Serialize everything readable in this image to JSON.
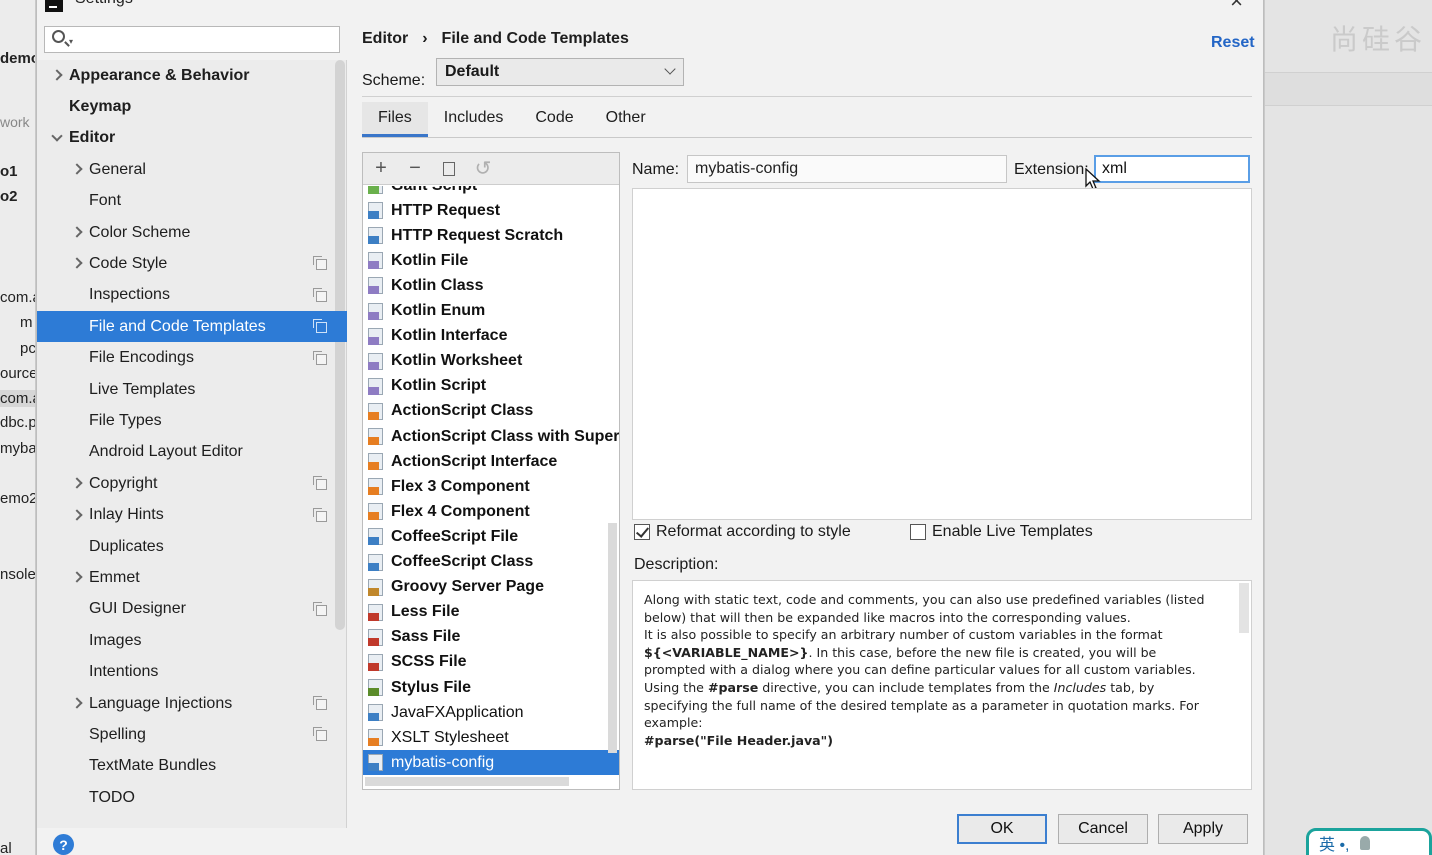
{
  "dialog": {
    "title": "Settings"
  },
  "search": {
    "placeholder": ""
  },
  "tree": [
    {
      "label": "Appearance & Behavior",
      "bold": true,
      "chevron": "right",
      "indent": 0,
      "copy": false
    },
    {
      "label": "Keymap",
      "bold": true,
      "chevron": "",
      "indent": 0,
      "copy": false
    },
    {
      "label": "Editor",
      "bold": true,
      "chevron": "down",
      "indent": 0,
      "copy": false
    },
    {
      "label": "General",
      "bold": false,
      "chevron": "right",
      "indent": 1,
      "copy": false
    },
    {
      "label": "Font",
      "bold": false,
      "chevron": "",
      "indent": 1,
      "copy": false
    },
    {
      "label": "Color Scheme",
      "bold": false,
      "chevron": "right",
      "indent": 1,
      "copy": false
    },
    {
      "label": "Code Style",
      "bold": false,
      "chevron": "right",
      "indent": 1,
      "copy": true
    },
    {
      "label": "Inspections",
      "bold": false,
      "chevron": "",
      "indent": 1,
      "copy": true
    },
    {
      "label": "File and Code Templates",
      "bold": false,
      "chevron": "",
      "indent": 1,
      "copy": true,
      "selected": true
    },
    {
      "label": "File Encodings",
      "bold": false,
      "chevron": "",
      "indent": 1,
      "copy": true
    },
    {
      "label": "Live Templates",
      "bold": false,
      "chevron": "",
      "indent": 1,
      "copy": false
    },
    {
      "label": "File Types",
      "bold": false,
      "chevron": "",
      "indent": 1,
      "copy": false
    },
    {
      "label": "Android Layout Editor",
      "bold": false,
      "chevron": "",
      "indent": 1,
      "copy": false
    },
    {
      "label": "Copyright",
      "bold": false,
      "chevron": "right",
      "indent": 1,
      "copy": true
    },
    {
      "label": "Inlay Hints",
      "bold": false,
      "chevron": "right",
      "indent": 1,
      "copy": true
    },
    {
      "label": "Duplicates",
      "bold": false,
      "chevron": "",
      "indent": 1,
      "copy": false
    },
    {
      "label": "Emmet",
      "bold": false,
      "chevron": "right",
      "indent": 1,
      "copy": false
    },
    {
      "label": "GUI Designer",
      "bold": false,
      "chevron": "",
      "indent": 1,
      "copy": true
    },
    {
      "label": "Images",
      "bold": false,
      "chevron": "",
      "indent": 1,
      "copy": false
    },
    {
      "label": "Intentions",
      "bold": false,
      "chevron": "",
      "indent": 1,
      "copy": false
    },
    {
      "label": "Language Injections",
      "bold": false,
      "chevron": "right",
      "indent": 1,
      "copy": true
    },
    {
      "label": "Spelling",
      "bold": false,
      "chevron": "",
      "indent": 1,
      "copy": true
    },
    {
      "label": "TextMate Bundles",
      "bold": false,
      "chevron": "",
      "indent": 1,
      "copy": false
    },
    {
      "label": "TODO",
      "bold": false,
      "chevron": "",
      "indent": 1,
      "copy": false
    }
  ],
  "breadcrumb": {
    "parent": "Editor",
    "separator": "›",
    "current": "File and Code Templates"
  },
  "reset_label": "Reset",
  "scheme": {
    "label": "Scheme:",
    "value": "Default"
  },
  "tabs": [
    "Files",
    "Includes",
    "Code",
    "Other"
  ],
  "active_tab": "Files",
  "toolbar": {
    "add": "+",
    "remove": "−",
    "copy_icon": "copy-icon",
    "revert": "↺"
  },
  "templates": [
    {
      "label": "Gant Script",
      "bold": true,
      "icon": "gant-file-icon",
      "color": "#6ab04c"
    },
    {
      "label": "HTTP Request",
      "bold": true,
      "icon": "api-file-icon",
      "color": "#3d7fc4"
    },
    {
      "label": "HTTP Request Scratch",
      "bold": true,
      "icon": "api-file-icon",
      "color": "#3d7fc4"
    },
    {
      "label": "Kotlin File",
      "bold": true,
      "icon": "kotlin-file-icon",
      "color": "#8e7cc3"
    },
    {
      "label": "Kotlin Class",
      "bold": true,
      "icon": "kotlin-file-icon",
      "color": "#8e7cc3"
    },
    {
      "label": "Kotlin Enum",
      "bold": true,
      "icon": "kotlin-file-icon",
      "color": "#8e7cc3"
    },
    {
      "label": "Kotlin Interface",
      "bold": true,
      "icon": "kotlin-file-icon",
      "color": "#8e7cc3"
    },
    {
      "label": "Kotlin Worksheet",
      "bold": true,
      "icon": "kotlin-file-icon",
      "color": "#8e7cc3"
    },
    {
      "label": "Kotlin Script",
      "bold": true,
      "icon": "kotlin-file-icon",
      "color": "#8e7cc3"
    },
    {
      "label": "ActionScript Class",
      "bold": true,
      "icon": "actionscript-file-icon",
      "color": "#e67e22"
    },
    {
      "label": "ActionScript Class with Supers",
      "bold": true,
      "icon": "actionscript-file-icon",
      "color": "#e67e22"
    },
    {
      "label": "ActionScript Interface",
      "bold": true,
      "icon": "actionscript-file-icon",
      "color": "#e67e22"
    },
    {
      "label": "Flex 3 Component",
      "bold": true,
      "icon": "flex-file-icon",
      "color": "#e67e22"
    },
    {
      "label": "Flex 4 Component",
      "bold": true,
      "icon": "flex-file-icon",
      "color": "#e67e22"
    },
    {
      "label": "CoffeeScript File",
      "bold": true,
      "icon": "coffeescript-file-icon",
      "color": "#3d7fc4"
    },
    {
      "label": "CoffeeScript Class",
      "bold": true,
      "icon": "coffeescript-file-icon",
      "color": "#3d7fc4"
    },
    {
      "label": "Groovy Server Page",
      "bold": true,
      "icon": "gsp-file-icon",
      "color": "#c0872b"
    },
    {
      "label": "Less File",
      "bold": true,
      "icon": "less-file-icon",
      "color": "#c0392b"
    },
    {
      "label": "Sass File",
      "bold": true,
      "icon": "sass-file-icon",
      "color": "#c0392b"
    },
    {
      "label": "SCSS File",
      "bold": true,
      "icon": "scss-file-icon",
      "color": "#c0392b"
    },
    {
      "label": "Stylus File",
      "bold": true,
      "icon": "stylus-file-icon",
      "color": "#5b8c2a"
    },
    {
      "label": "JavaFXApplication",
      "bold": false,
      "icon": "java-file-icon",
      "color": "#3d7fc4"
    },
    {
      "label": "XSLT Stylesheet",
      "bold": false,
      "icon": "xslt-file-icon",
      "color": "#e67e22"
    },
    {
      "label": "mybatis-config",
      "bold": false,
      "icon": "xml-file-icon",
      "color": "#3d7fc4",
      "selected": true
    }
  ],
  "name_field": {
    "label": "Name:",
    "value": "mybatis-config"
  },
  "extension_field": {
    "label": "Extension:",
    "value": "xml"
  },
  "reformat": {
    "label": "Reformat according to style",
    "checked": true
  },
  "live_templates": {
    "label": "Enable Live Templates",
    "checked": false
  },
  "description": {
    "label": "Description:",
    "p1": "Along with static text, code and comments, you can also use predefined variables (listed below) that will then be expanded like macros into the corresponding values.",
    "p2_a": "It is also possible to specify an arbitrary number of custom variables in the format ",
    "p2_code": "${<VARIABLE_NAME>}",
    "p2_b": ". In this case, before the new file is created, you will be prompted with a dialog where you can define particular values for all custom variables.",
    "p3_a": "Using the ",
    "p3_code": "#parse",
    "p3_b": " directive, you can include templates from the ",
    "p3_em": "Includes",
    "p3_c": " tab, by specifying the full name of the desired template as a parameter in quotation marks. For example:",
    "p4_code": "#parse(\"File Header.java\")"
  },
  "buttons": {
    "ok": "OK",
    "cancel": "Cancel",
    "apply": "Apply",
    "help": "?"
  },
  "background": {
    "ide_fragments": [
      "demo",
      "work",
      "o1",
      "o2",
      "com.a",
      "m",
      "pc",
      "ource",
      "com.a",
      "dbc.p",
      "myba",
      "emo2",
      "nsole",
      "al"
    ],
    "watermark": "尚硅谷",
    "ime": "英 •,"
  },
  "colors": {
    "selection": "#2d7bd6",
    "link": "#2466c6",
    "focus": "#5a9ee6"
  }
}
